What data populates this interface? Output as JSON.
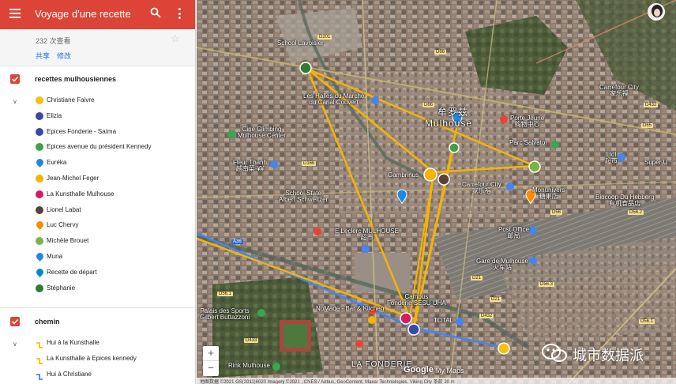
{
  "header": {
    "title": "Voyage d'une recette",
    "views": "232 次查看",
    "share_label": "共享",
    "edit_label": "修改"
  },
  "layers": [
    {
      "title": "recettes mulhousiennes",
      "items": [
        {
          "label": "Christiane Faivre",
          "icon": "circle-icon",
          "color": "#f4c20d"
        },
        {
          "label": "Elizia",
          "icon": "circle-icon",
          "color": "#3949ab"
        },
        {
          "label": "Epices Fonderie - Saïma",
          "icon": "circle-icon",
          "color": "#3949ab"
        },
        {
          "label": "Epices avenue du président Kennedy",
          "icon": "circle-icon",
          "color": "#43a047"
        },
        {
          "label": "Euréka",
          "icon": "pin-icon",
          "color": "#1e88e5"
        },
        {
          "label": "Jean-Michel Feger",
          "icon": "circle-icon",
          "color": "#f4b400"
        },
        {
          "label": "La Kunsthalle Mulhouse",
          "icon": "circle-icon",
          "color": "#d81b60"
        },
        {
          "label": "Lionel Labat",
          "icon": "circle-icon",
          "color": "#5d4037"
        },
        {
          "label": "Luc Chervy",
          "icon": "pin-icon",
          "color": "#fb8c00"
        },
        {
          "label": "Michèle Brouet",
          "icon": "circle-icon",
          "color": "#7cb342"
        },
        {
          "label": "Muna",
          "icon": "pin-icon",
          "color": "#1e88e5"
        },
        {
          "label": "Recette de départ",
          "icon": "pin-icon",
          "color": "#0288d1"
        },
        {
          "label": "Stéphanie",
          "icon": "circle-icon",
          "color": "#2e7d32"
        }
      ]
    },
    {
      "title": "chemin",
      "items": [
        {
          "label": "Hui à la Kunsthalle",
          "icon": "route-icon",
          "color": "#f4c20d"
        },
        {
          "label": "La Kunsthalle à Epices kennedy",
          "icon": "route-icon",
          "color": "#f4c20d"
        },
        {
          "label": "Hui à Christiane",
          "icon": "route-icon",
          "color": "#4285f4"
        }
      ]
    }
  ],
  "map": {
    "labels": {
      "school_lavoisier": "School Lavoisier",
      "halles": "Les Halles du Marché\ndu Canal Couvert",
      "mulhouse_cn": "牟罗兹",
      "mulhouse": "Mulhouse",
      "porte_jeune": "Porte Jeune\n购物中心",
      "parc_salvator": "Parc Salvator",
      "carrefour_city1": "Carrefour City\n家乐福",
      "cine_climbing": "Cine Climbing\nMulhouse Center",
      "fleur_thanh": "Fleur Thanh\n越南菜·¥¥",
      "lidl": "Lidl\n超市",
      "super_u": "Super U",
      "gambrinus": "Gambrinus",
      "school_schweitzer": "School State\nAlbert Schweitzer",
      "carrefour_city2": "Carrefour City\n家乐福",
      "monunivers": "Monunivers\n糖果店",
      "biocoop": "Biocoop Du Hebberg\n有机食品店",
      "leclerc": "E.Leclerc MULHOUSE\n超市",
      "post_office": "Post Office\n邮局",
      "gare": "Gare de Mulhouse\n火车站",
      "campus": "Campus\nFonderie SESU UHA",
      "nomad": "NoMade - Bar & Kitchen",
      "total": "TOTAL",
      "palais": "Palais des Sports\nGilbert Buttazzoni",
      "rink": "Rink Mulhouse",
      "fonderie": "LA FONDERIE"
    },
    "roads": [
      "D201",
      "D66",
      "D166",
      "D432",
      "D65",
      "D56",
      "D56.2",
      "D56.3",
      "D21",
      "D66",
      "D433",
      "D432",
      "D56.1",
      "D21",
      "D56.1"
    ],
    "road_blue": "A36",
    "zoom_in": "+",
    "zoom_out": "−",
    "google": "Google",
    "mymaps": "My Maps",
    "attribution": "地图数据 ©2021 GS(2011)6020 Imagery ©2021 , CNES / Airbus, GeoContent, Maxar Technologies, Viking City      条款    20 m",
    "watermark": "城市数据派"
  },
  "colors": {
    "header_red": "#db4437",
    "route_yellow": "#f4b400",
    "route_blue": "#4285f4"
  }
}
